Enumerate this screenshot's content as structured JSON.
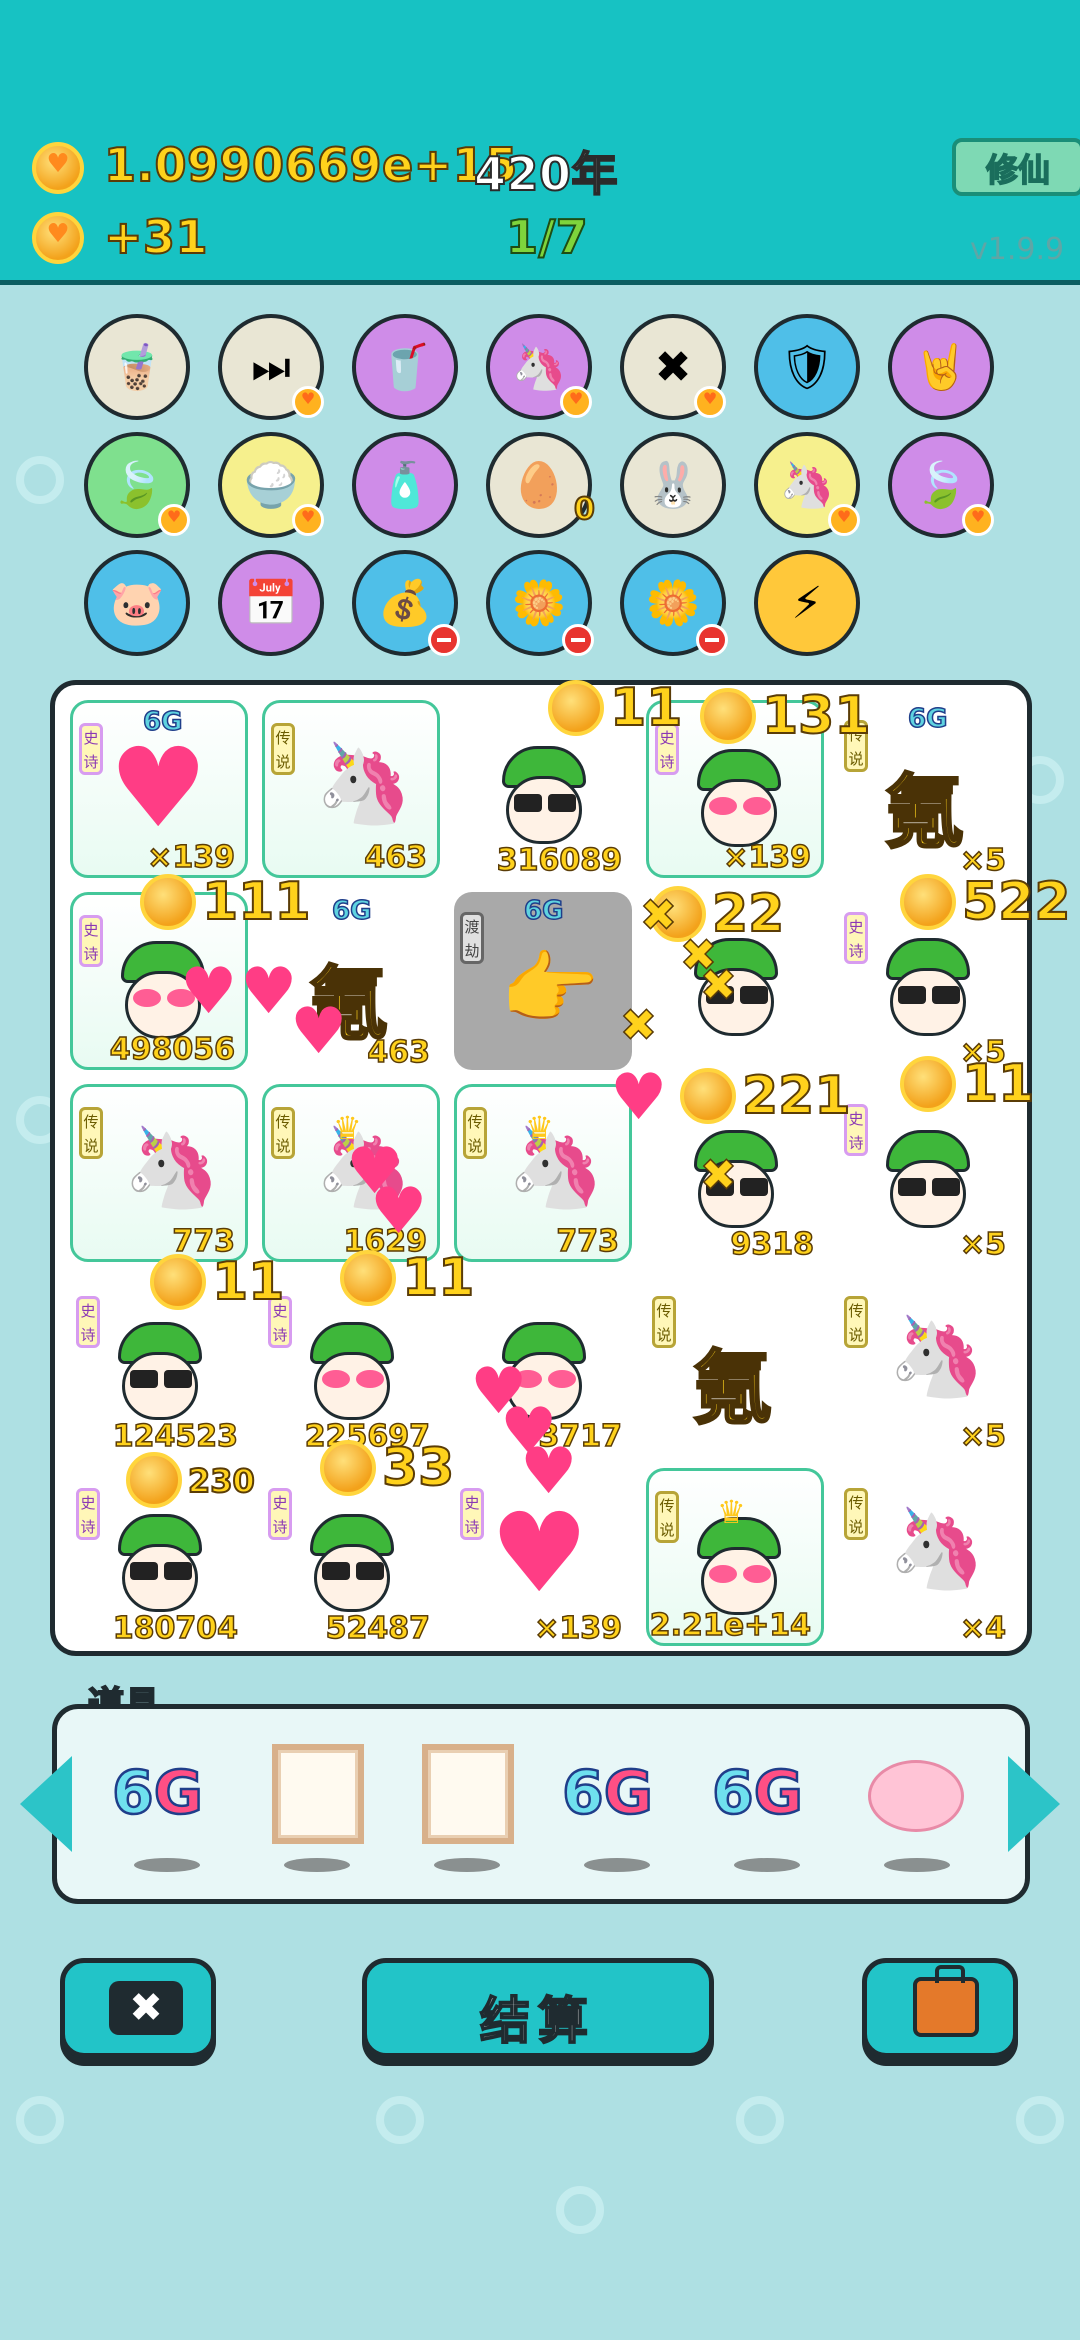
{
  "header": {
    "coins": "1.0990669e+15",
    "year": "420年",
    "income": "+31",
    "page": "1/7",
    "xiuxian_label": "修仙",
    "version": "v1.9.9"
  },
  "skills": [
    {
      "name": "bubble-tea-icon",
      "bg": "#e9e6d4",
      "glyph": "🧋",
      "badge": ""
    },
    {
      "name": "skip-icon",
      "bg": "#e9e6d4",
      "glyph": "⏭",
      "badge": "heart"
    },
    {
      "name": "bubble-tea-100-icon",
      "bg": "#cf8ce8",
      "glyph": "🥤",
      "badge": ""
    },
    {
      "name": "twin-unicorns-icon",
      "bg": "#cf8ce8",
      "glyph": "🦄",
      "badge": "heart"
    },
    {
      "name": "delete-tag-icon",
      "bg": "#e9e6d4",
      "glyph": "✖",
      "badge": "heart"
    },
    {
      "name": "shield-wrench-icon",
      "bg": "#4fbfe8",
      "glyph": "🛡",
      "badge": ""
    },
    {
      "name": "rock-hand-icon",
      "bg": "#cf8ce8",
      "glyph": "🤘",
      "badge": ""
    },
    {
      "name": "leaf-icon",
      "bg": "#7fe08e",
      "glyph": "🍃",
      "badge": "heart"
    },
    {
      "name": "rice-bowl-icon",
      "bg": "#f6f08d",
      "glyph": "🍚",
      "badge": "heart"
    },
    {
      "name": "spray-bottle-icon",
      "bg": "#cf8ce8",
      "glyph": "🧴",
      "badge": ""
    },
    {
      "name": "egg-tray-icon",
      "bg": "#e9e6d4",
      "glyph": "🥚",
      "badge": "",
      "count": "0"
    },
    {
      "name": "bunny-icon",
      "bg": "#e9e6d4",
      "glyph": "🐰",
      "badge": ""
    },
    {
      "name": "unicorn-icon",
      "bg": "#f6f08d",
      "glyph": "🦄",
      "badge": "heart"
    },
    {
      "name": "leaf-icon-2",
      "bg": "#cf8ce8",
      "glyph": "🍃",
      "badge": "heart"
    },
    {
      "name": "piggy-bank-icon",
      "bg": "#4fbfe8",
      "glyph": "🐷",
      "badge": ""
    },
    {
      "name": "calendar-icon",
      "bg": "#cf8ce8",
      "glyph": "📅",
      "badge": ""
    },
    {
      "name": "money-bag-icon",
      "bg": "#4fbfe8",
      "glyph": "💰",
      "badge": "minus"
    },
    {
      "name": "flower-pot-icon",
      "bg": "#4fbfe8",
      "glyph": "🌼",
      "badge": "minus"
    },
    {
      "name": "flower-pot-icon-2",
      "bg": "#4fbfe8",
      "glyph": "🌼",
      "badge": "minus"
    },
    {
      "name": "lightning-icon",
      "bg": "#ffc83a",
      "glyph": "⚡",
      "badge": ""
    }
  ],
  "board": {
    "cells": [
      {
        "kind": "heart",
        "tag": "史诗",
        "g": "6G",
        "value": "×139",
        "green": true
      },
      {
        "kind": "unicorn",
        "tag": "传说",
        "value": "463",
        "green": true
      },
      {
        "kind": "face",
        "tag": "",
        "value": "316089",
        "glasses": "black"
      },
      {
        "kind": "face",
        "tag": "史诗",
        "value": "×139",
        "green": true,
        "glasses": "pink"
      },
      {
        "kind": "char",
        "tag": "传说",
        "g": "6G",
        "char": "氪",
        "value": "×5"
      },
      {
        "kind": "face",
        "tag": "史诗",
        "value": "498056",
        "green": true,
        "glasses": "pink"
      },
      {
        "kind": "char",
        "tag": "",
        "g": "6G",
        "char": "氪",
        "value": "463"
      },
      {
        "kind": "hand",
        "tag": "渡劫",
        "g": "6G",
        "value": "",
        "gray": true
      },
      {
        "kind": "face",
        "tag": "",
        "value": "",
        "glasses": "black"
      },
      {
        "kind": "face",
        "tag": "史诗",
        "value": "×5",
        "glasses": "black"
      },
      {
        "kind": "unicorn",
        "tag": "传说",
        "value": "773",
        "green": true
      },
      {
        "kind": "unicorn",
        "tag": "传说",
        "value": "1629",
        "green": true,
        "crown": true
      },
      {
        "kind": "unicorn",
        "tag": "传说",
        "value": "773",
        "green": true,
        "crown": true
      },
      {
        "kind": "face",
        "tag": "",
        "value": "9318",
        "glasses": "black"
      },
      {
        "kind": "face",
        "tag": "史诗",
        "value": "×5",
        "glasses": "black"
      },
      {
        "kind": "face",
        "tag": "史诗",
        "value": "124523",
        "glasses": "black"
      },
      {
        "kind": "face",
        "tag": "史诗",
        "value": "225697",
        "glasses": "pink"
      },
      {
        "kind": "face",
        "tag": "",
        "value": "3717",
        "glasses": "pink"
      },
      {
        "kind": "char",
        "tag": "传说",
        "char": "氪",
        "value": ""
      },
      {
        "kind": "unicorn",
        "tag": "传说",
        "value": "×5"
      },
      {
        "kind": "face",
        "tag": "史诗",
        "value": "180704",
        "glasses": "black"
      },
      {
        "kind": "face",
        "tag": "史诗",
        "value": "52487",
        "glasses": "black"
      },
      {
        "kind": "heart",
        "tag": "史诗",
        "value": "×139"
      },
      {
        "kind": "face",
        "tag": "传说",
        "value": "2.21e+14",
        "green": true,
        "glasses": "pink",
        "crown": true
      },
      {
        "kind": "unicorn",
        "tag": "传说",
        "value": "×4"
      }
    ],
    "floats": [
      {
        "text": "11"
      },
      {
        "text": "131"
      },
      {
        "text": "111"
      },
      {
        "text": "22"
      },
      {
        "text": "522"
      },
      {
        "text": "221"
      },
      {
        "text": "11"
      },
      {
        "text": "11"
      },
      {
        "text": "11"
      },
      {
        "text": "230"
      },
      {
        "text": "33"
      }
    ]
  },
  "items": {
    "label": "道具",
    "list": [
      {
        "type": "6g",
        "g": "6",
        "rest": "G"
      },
      {
        "type": "frame"
      },
      {
        "type": "frame"
      },
      {
        "type": "6g",
        "g": "6",
        "rest": "G"
      },
      {
        "type": "6g",
        "g": "6",
        "rest": "G"
      },
      {
        "type": "pig"
      }
    ]
  },
  "buttons": {
    "settle_label": "结算"
  }
}
